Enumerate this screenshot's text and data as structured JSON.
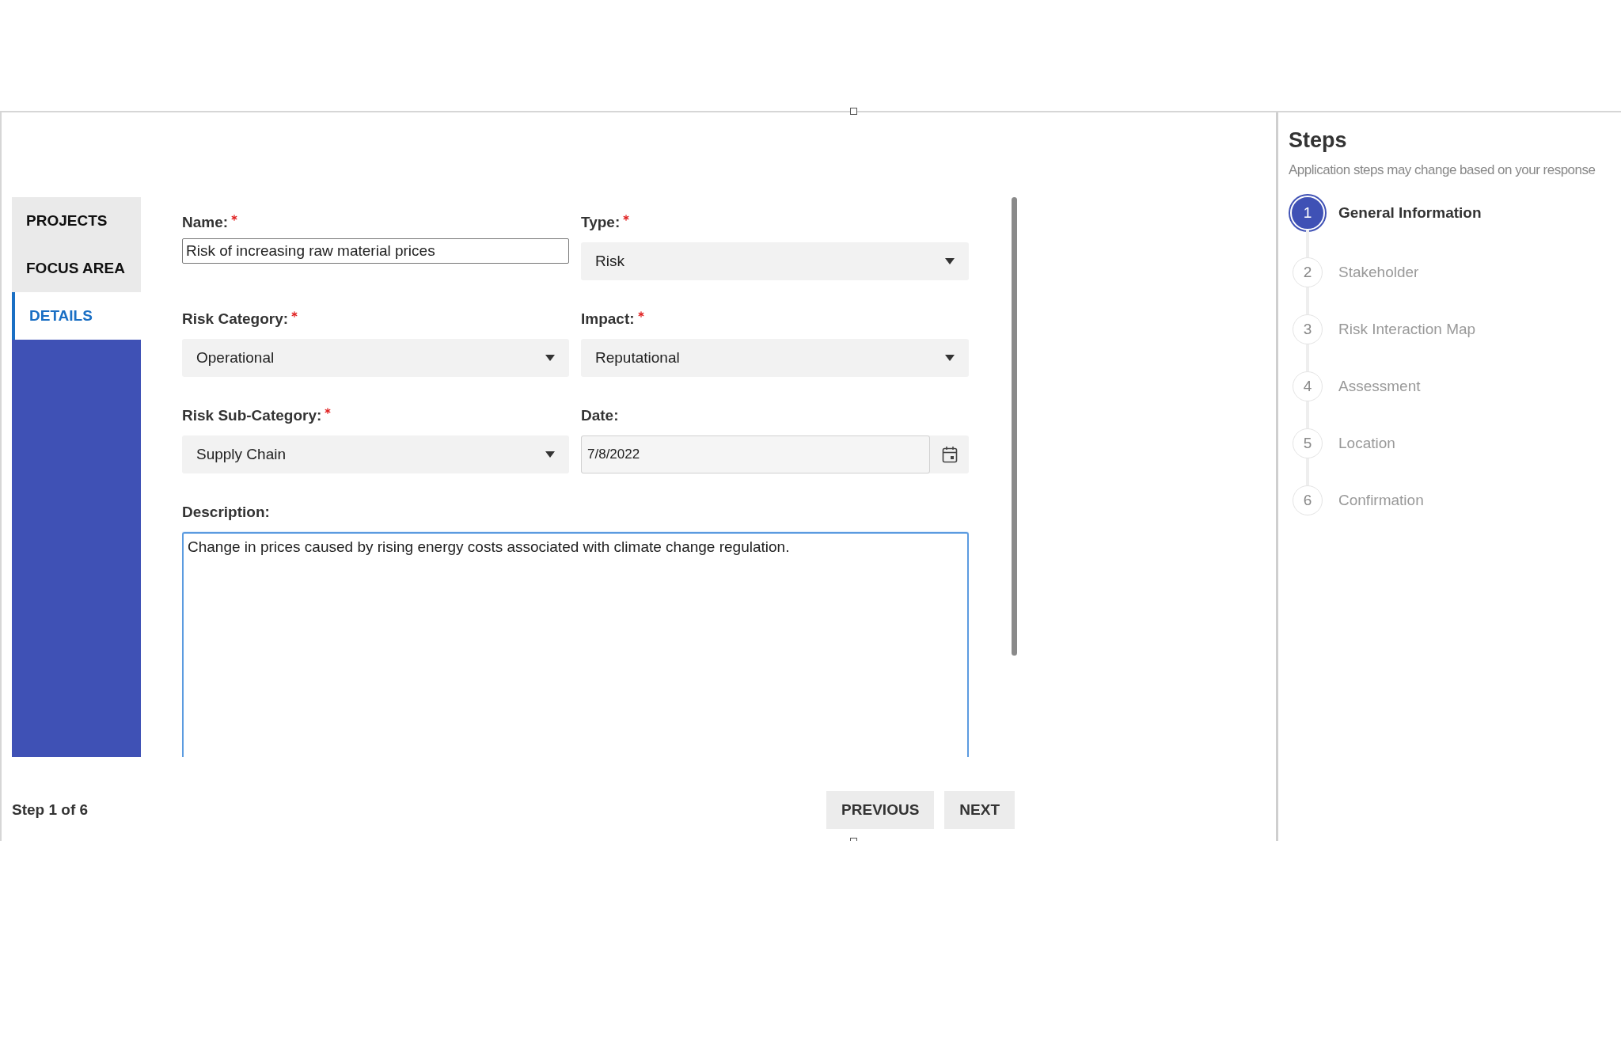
{
  "nav": {
    "items": [
      {
        "label": "PROJECTS",
        "selected": false
      },
      {
        "label": "FOCUS AREA",
        "selected": false
      },
      {
        "label": "DETAILS",
        "selected": true
      }
    ]
  },
  "form": {
    "fields": [
      {
        "kind": "text",
        "label": "Name:",
        "required": true,
        "value": "Risk of increasing raw material prices"
      },
      {
        "kind": "select",
        "label": "Type:",
        "required": true,
        "value": "Risk"
      },
      {
        "kind": "select",
        "label": "Risk Category:",
        "required": true,
        "value": "Operational"
      },
      {
        "kind": "select",
        "label": "Impact:",
        "required": true,
        "value": "Reputational"
      },
      {
        "kind": "select",
        "label": "Risk Sub-Category:",
        "required": true,
        "value": "Supply Chain"
      },
      {
        "kind": "date",
        "label": "Date:",
        "required": false,
        "value": "7/8/2022"
      },
      {
        "kind": "textarea",
        "label": "Description:",
        "required": false,
        "value": "Change in prices caused by rising energy costs associated with climate change regulation."
      }
    ]
  },
  "footer": {
    "step_text": "Step 1 of 6",
    "buttons": [
      "PREVIOUS",
      "NEXT"
    ]
  },
  "steps": {
    "title": "Steps",
    "subtitle": "Application steps may change based on your response",
    "items": [
      {
        "number": "1",
        "label": "General Information",
        "selected": true
      },
      {
        "number": "2",
        "label": "Stakeholder",
        "selected": false
      },
      {
        "number": "3",
        "label": "Risk Interaction Map",
        "selected": false
      },
      {
        "number": "4",
        "label": "Assessment",
        "selected": false
      },
      {
        "number": "5",
        "label": "Location",
        "selected": false
      },
      {
        "number": "6",
        "label": "Confirmation",
        "selected": false
      }
    ]
  }
}
